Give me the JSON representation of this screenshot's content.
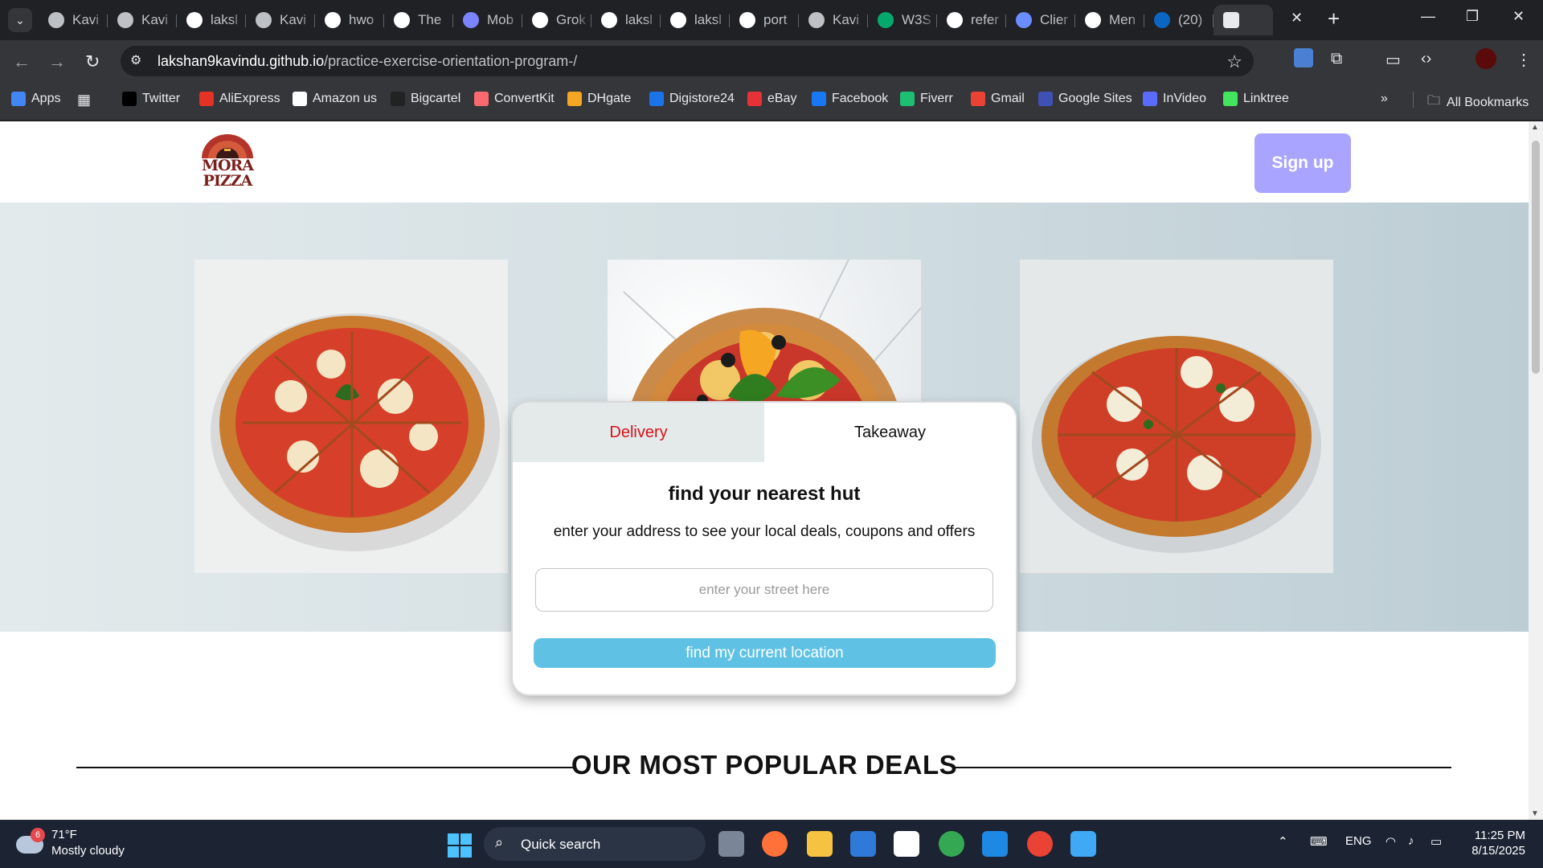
{
  "browser": {
    "tabs": [
      {
        "title": "Kavi",
        "icon": "globe-icon",
        "color": "#bdc1c6"
      },
      {
        "title": "Kavi",
        "icon": "globe-icon",
        "color": "#bdc1c6"
      },
      {
        "title": "laksl",
        "icon": "github-icon",
        "color": "#ffffff"
      },
      {
        "title": "Kavi",
        "icon": "globe-icon",
        "color": "#bdc1c6"
      },
      {
        "title": "hwo",
        "icon": "google-icon",
        "color": "#ffffff"
      },
      {
        "title": "The",
        "icon": "medium-icon",
        "color": "#ffffff"
      },
      {
        "title": "Mob",
        "icon": "mobbin-icon",
        "color": "#7b83ff"
      },
      {
        "title": "Grok",
        "icon": "grok-icon",
        "color": "#ffffff"
      },
      {
        "title": "laksl",
        "icon": "github-icon",
        "color": "#ffffff"
      },
      {
        "title": "laksl",
        "icon": "github-icon",
        "color": "#ffffff"
      },
      {
        "title": "port",
        "icon": "github-icon",
        "color": "#ffffff"
      },
      {
        "title": "Kavi",
        "icon": "globe-icon",
        "color": "#bdc1c6"
      },
      {
        "title": "W3S",
        "icon": "w3schools-icon",
        "color": "#04aa6d"
      },
      {
        "title": "refer",
        "icon": "google-icon",
        "color": "#ffffff"
      },
      {
        "title": "Clier",
        "icon": "client-icon",
        "color": "#6b8cff"
      },
      {
        "title": "Men",
        "icon": "openai-icon",
        "color": "#ffffff"
      },
      {
        "title": "(20)",
        "icon": "linkedin-icon",
        "color": "#0a66c2"
      }
    ],
    "url_host": "lakshan9kavindu.github.io",
    "url_path": "/practice-exercise-orientation-program-/",
    "bookmarks": [
      {
        "label": "Apps",
        "color": "#4285f4"
      },
      {
        "label": "Twitter",
        "color": "#000000"
      },
      {
        "label": "AliExpress",
        "color": "#e43225"
      },
      {
        "label": "Amazon us",
        "color": "#ffffff"
      },
      {
        "label": "Bigcartel",
        "color": "#222222"
      },
      {
        "label": "ConvertKit",
        "color": "#fb6970"
      },
      {
        "label": "DHgate",
        "color": "#f5a623"
      },
      {
        "label": "Digistore24",
        "color": "#1a73e8"
      },
      {
        "label": "eBay",
        "color": "#e53238"
      },
      {
        "label": "Facebook",
        "color": "#1877f2"
      },
      {
        "label": "Fiverr",
        "color": "#1dbf73"
      },
      {
        "label": "Gmail",
        "color": "#ea4335"
      },
      {
        "label": "Google Sites",
        "color": "#3f51b5"
      },
      {
        "label": "InVideo",
        "color": "#5b6bff"
      },
      {
        "label": "Linktree",
        "color": "#43e55e"
      }
    ],
    "all_bookmarks": "All Bookmarks"
  },
  "site": {
    "logo_line1": "MORA",
    "logo_line2": "PIZZA",
    "signup_label": "Sign up",
    "finder": {
      "tab_delivery": "Delivery",
      "tab_takeaway": "Takeaway",
      "title": "find your nearest hut",
      "subtitle": "enter your address to see your local deals, coupons and offers",
      "input_placeholder": "enter your street here",
      "location_button": "find my current location"
    },
    "deals_heading": "OUR MOST POPULAR DEALS",
    "colors": {
      "signup": "#a9a4ff",
      "delivery_text": "#d9111b",
      "location_button": "#5fc2e4"
    }
  },
  "taskbar": {
    "weather_temp": "71°F",
    "weather_condition": "Mostly cloudy",
    "weather_badge": "6",
    "search_label": "Quick search",
    "language": "ENG",
    "time": "11:25 PM",
    "date": "8/15/2025"
  }
}
